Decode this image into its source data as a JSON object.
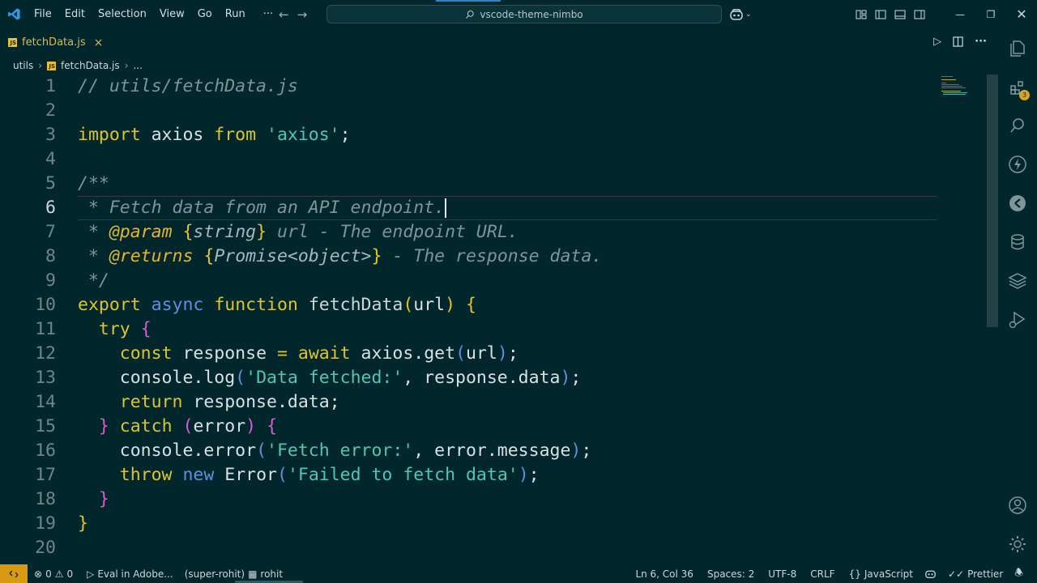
{
  "menu": [
    "File",
    "Edit",
    "Selection",
    "View",
    "Go",
    "Run",
    "···"
  ],
  "search": {
    "text": "vscode-theme-nimbo"
  },
  "tab": {
    "label": "fetchData.js",
    "close": "×",
    "icon": "js-file-icon"
  },
  "breadcrumb": {
    "folder": "utils",
    "file": "fetchData.js",
    "more": "..."
  },
  "editor": {
    "active_line": 6,
    "lines": [
      [
        {
          "t": "// utils/fetchData.js",
          "c": "c-com"
        }
      ],
      [],
      [
        {
          "t": "import",
          "c": "c-kw"
        },
        {
          "t": " axios ",
          "c": "c-id"
        },
        {
          "t": "from",
          "c": "c-kw"
        },
        {
          "t": " ",
          "c": "c-id"
        },
        {
          "t": "'axios'",
          "c": "c-str"
        },
        {
          "t": ";",
          "c": "c-id"
        }
      ],
      [],
      [
        {
          "t": "/**",
          "c": "c-com"
        }
      ],
      [
        {
          "t": " * Fetch data from an API endpoint.",
          "c": "c-com"
        }
      ],
      [
        {
          "t": " * ",
          "c": "c-com"
        },
        {
          "t": "@param",
          "c": "c-tag"
        },
        {
          "t": " ",
          "c": "c-com"
        },
        {
          "t": "{",
          "c": "c-p1"
        },
        {
          "t": "string",
          "c": "c-type"
        },
        {
          "t": "}",
          "c": "c-p1"
        },
        {
          "t": " url - The endpoint URL.",
          "c": "c-com"
        }
      ],
      [
        {
          "t": " * ",
          "c": "c-com"
        },
        {
          "t": "@returns",
          "c": "c-tag"
        },
        {
          "t": " ",
          "c": "c-com"
        },
        {
          "t": "{",
          "c": "c-p1"
        },
        {
          "t": "Promise<object>",
          "c": "c-type"
        },
        {
          "t": "}",
          "c": "c-p1"
        },
        {
          "t": " - The response data.",
          "c": "c-com"
        }
      ],
      [
        {
          "t": " */",
          "c": "c-com"
        }
      ],
      [
        {
          "t": "export",
          "c": "c-kw"
        },
        {
          "t": " ",
          "c": "c-id"
        },
        {
          "t": "async",
          "c": "c-kw2"
        },
        {
          "t": " ",
          "c": "c-id"
        },
        {
          "t": "function",
          "c": "c-kw"
        },
        {
          "t": " fetchData",
          "c": "c-fn"
        },
        {
          "t": "(",
          "c": "c-p1"
        },
        {
          "t": "url",
          "c": "c-id"
        },
        {
          "t": ")",
          "c": "c-p1"
        },
        {
          "t": " ",
          "c": "c-id"
        },
        {
          "t": "{",
          "c": "c-p1"
        }
      ],
      [
        {
          "t": "  ",
          "c": "c-id"
        },
        {
          "t": "try",
          "c": "c-kw"
        },
        {
          "t": " ",
          "c": "c-id"
        },
        {
          "t": "{",
          "c": "c-p2"
        }
      ],
      [
        {
          "t": "    ",
          "c": "c-id"
        },
        {
          "t": "const",
          "c": "c-kw"
        },
        {
          "t": " response ",
          "c": "c-id"
        },
        {
          "t": "=",
          "c": "c-kw"
        },
        {
          "t": " ",
          "c": "c-id"
        },
        {
          "t": "await",
          "c": "c-kw"
        },
        {
          "t": " axios.get",
          "c": "c-id"
        },
        {
          "t": "(",
          "c": "c-kw2"
        },
        {
          "t": "url",
          "c": "c-id"
        },
        {
          "t": ")",
          "c": "c-kw2"
        },
        {
          "t": ";",
          "c": "c-id"
        }
      ],
      [
        {
          "t": "    console.log",
          "c": "c-id"
        },
        {
          "t": "(",
          "c": "c-kw2"
        },
        {
          "t": "'Data fetched:'",
          "c": "c-str"
        },
        {
          "t": ", response.data",
          "c": "c-id"
        },
        {
          "t": ")",
          "c": "c-kw2"
        },
        {
          "t": ";",
          "c": "c-id"
        }
      ],
      [
        {
          "t": "    ",
          "c": "c-id"
        },
        {
          "t": "return",
          "c": "c-kw"
        },
        {
          "t": " response.data;",
          "c": "c-id"
        }
      ],
      [
        {
          "t": "  ",
          "c": "c-id"
        },
        {
          "t": "}",
          "c": "c-p2"
        },
        {
          "t": " ",
          "c": "c-id"
        },
        {
          "t": "catch",
          "c": "c-kw"
        },
        {
          "t": " ",
          "c": "c-id"
        },
        {
          "t": "(",
          "c": "c-p2"
        },
        {
          "t": "error",
          "c": "c-id"
        },
        {
          "t": ")",
          "c": "c-p2"
        },
        {
          "t": " ",
          "c": "c-id"
        },
        {
          "t": "{",
          "c": "c-p2"
        }
      ],
      [
        {
          "t": "    console.error",
          "c": "c-id"
        },
        {
          "t": "(",
          "c": "c-kw2"
        },
        {
          "t": "'Fetch error:'",
          "c": "c-str"
        },
        {
          "t": ", error.message",
          "c": "c-id"
        },
        {
          "t": ")",
          "c": "c-kw2"
        },
        {
          "t": ";",
          "c": "c-id"
        }
      ],
      [
        {
          "t": "    ",
          "c": "c-id"
        },
        {
          "t": "throw",
          "c": "c-kw"
        },
        {
          "t": " ",
          "c": "c-id"
        },
        {
          "t": "new",
          "c": "c-kw2"
        },
        {
          "t": " Error",
          "c": "c-id"
        },
        {
          "t": "(",
          "c": "c-kw2"
        },
        {
          "t": "'Failed to fetch data'",
          "c": "c-str"
        },
        {
          "t": ")",
          "c": "c-kw2"
        },
        {
          "t": ";",
          "c": "c-id"
        }
      ],
      [
        {
          "t": "  ",
          "c": "c-id"
        },
        {
          "t": "}",
          "c": "c-p2"
        }
      ],
      [
        {
          "t": "}",
          "c": "c-p1"
        }
      ],
      []
    ]
  },
  "activity_badge": "3",
  "status": {
    "errors": "0",
    "warnings": "0",
    "run_label": "Eval in Adobe...",
    "branch_user": "(super-rohit)",
    "user": "rohit",
    "position": "Ln 6, Col 36",
    "spaces": "Spaces: 2",
    "encoding": "UTF-8",
    "eol": "CRLF",
    "language": "JavaScript",
    "formatter": "Prettier"
  },
  "colors": {
    "background": "#01272c",
    "accent": "#e8c516",
    "remote": "#d99a14"
  }
}
